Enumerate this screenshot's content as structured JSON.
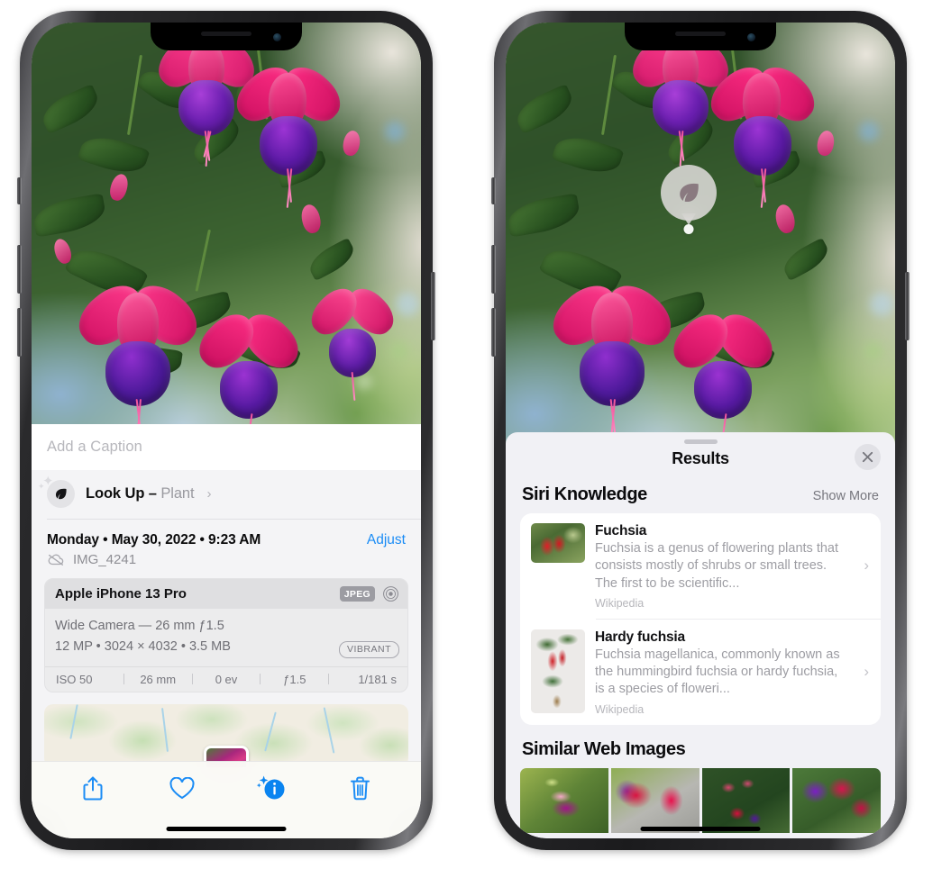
{
  "left_phone": {
    "caption_placeholder": "Add a Caption",
    "lookup": {
      "label": "Look Up –",
      "subject": "Plant",
      "chevron": "›",
      "icon": "leaf-icon"
    },
    "date_line": "Monday • May 30, 2022 • 9:23 AM",
    "adjust_label": "Adjust",
    "file_name": "IMG_4241",
    "cloud_icon": "cloud-slash-icon",
    "exif": {
      "device": "Apple iPhone 13 Pro",
      "format_tag": "JPEG",
      "aperture_icon": "aperture-icon",
      "lens_line": "Wide Camera — 26 mm ƒ1.5",
      "size_line": "12 MP • 3024 × 4032 • 3.5 MB",
      "style_tag": "VIBRANT",
      "stats": [
        "ISO 50",
        "26 mm",
        "0 ev",
        "ƒ1.5",
        "1/181 s"
      ]
    },
    "toolbar": [
      {
        "name": "share-button",
        "icon": "share-icon"
      },
      {
        "name": "favorite-button",
        "icon": "heart-icon"
      },
      {
        "name": "info-button",
        "icon": "info-sparkle-icon"
      },
      {
        "name": "delete-button",
        "icon": "trash-icon"
      }
    ]
  },
  "right_phone": {
    "badge_icon": "leaf-icon",
    "sheet_title": "Results",
    "close_icon": "close-icon",
    "siri_section": {
      "title": "Siri Knowledge",
      "show_more": "Show More",
      "items": [
        {
          "title": "Fuchsia",
          "description": "Fuchsia is a genus of flowering plants that consists mostly of shrubs or small trees. The first to be scientific...",
          "source": "Wikipedia",
          "chevron": "›"
        },
        {
          "title": "Hardy fuchsia",
          "description": "Fuchsia magellanica, commonly known as the hummingbird fuchsia or hardy fuchsia, is a species of floweri...",
          "source": "Wikipedia",
          "chevron": "›"
        }
      ]
    },
    "web_section": {
      "title": "Similar Web Images",
      "thumbnails": [
        "web-thumb-1",
        "web-thumb-2",
        "web-thumb-3",
        "web-thumb-4"
      ]
    }
  },
  "colors": {
    "accent_blue": "#1b8cf5",
    "sheet_bg": "#f1f1f5",
    "card_bg": "#ffffff",
    "muted_text": "#9d9da3",
    "tag_grey": "#9c9ca2"
  }
}
